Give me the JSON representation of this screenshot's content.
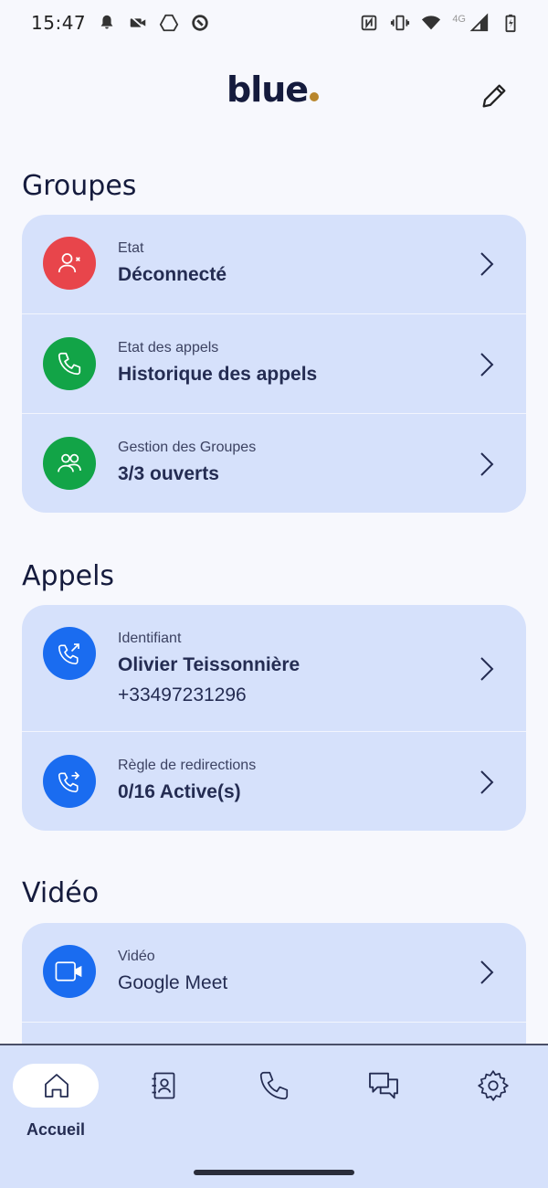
{
  "status_bar": {
    "time": "15:47",
    "network": "4G",
    "icons_left": [
      "notification-bell-icon",
      "video-off-icon",
      "drive-icon",
      "sync-icon"
    ],
    "icons_right": [
      "nfc-icon",
      "vibrate-icon",
      "wifi-icon",
      "signal-icon",
      "battery-icon"
    ]
  },
  "header": {
    "logo_text": "blue",
    "logo_accent_color": "#b8862c",
    "edit_icon": "pencil-icon"
  },
  "sections": {
    "groupes": {
      "title": "Groupes",
      "rows": [
        {
          "label": "Etat",
          "value": "Déconnecté",
          "icon": "user-x-icon",
          "color": "#e8454b"
        },
        {
          "label": "Etat des appels",
          "value": "Historique des appels",
          "icon": "phone-icon",
          "color": "#12a447"
        },
        {
          "label": "Gestion des Groupes",
          "value": "3/3 ouverts",
          "icon": "group-icon",
          "color": "#12a447"
        }
      ]
    },
    "appels": {
      "title": "Appels",
      "rows": [
        {
          "label": "Identifiant",
          "value": "Olivier Teissonnière",
          "sub": "+33497231296",
          "icon": "phone-outgoing-icon",
          "color": "#1a6cf0"
        },
        {
          "label": "Règle de redirections",
          "value": "0/16 Active(s)",
          "icon": "phone-forward-icon",
          "color": "#1a6cf0"
        }
      ]
    },
    "video": {
      "title": "Vidéo",
      "rows": [
        {
          "label": "Vidéo",
          "value": "Google Meet",
          "icon": "video-camera-icon",
          "color": "#1a6cf0"
        }
      ]
    }
  },
  "bottom_nav": {
    "active_label": "Accueil",
    "items": [
      {
        "icon": "home-icon",
        "label": "Accueil"
      },
      {
        "icon": "contacts-icon"
      },
      {
        "icon": "phone-icon"
      },
      {
        "icon": "chat-icon"
      },
      {
        "icon": "settings-gear-icon"
      }
    ]
  }
}
